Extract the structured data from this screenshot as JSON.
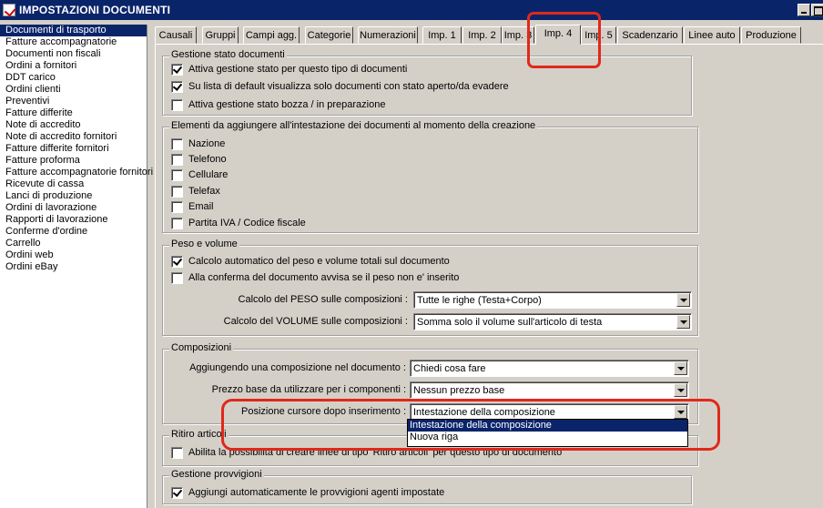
{
  "window": {
    "title": "IMPOSTAZIONI DOCUMENTI",
    "highlight_color": "#e0281a",
    "selection_color": "#0a246a"
  },
  "doc_list": [
    "Documenti di trasporto",
    "Fatture accompagnatorie",
    "Documenti non fiscali",
    "Ordini a fornitori",
    "DDT carico",
    "Ordini clienti",
    "Preventivi",
    "Fatture differite",
    "Note di accredito",
    "Note di accredito fornitori",
    "Fatture differite fornitori",
    "Fatture proforma",
    "Fatture accompagnatorie fornitori",
    "Ricevute di cassa",
    "Lanci di produzione",
    "Ordini di lavorazione",
    "Rapporti di lavorazione",
    "Conferme d'ordine",
    "Carrello",
    "Ordini web",
    "Ordini eBay"
  ],
  "doc_list_selected": "Documenti di trasporto",
  "tabs": [
    "Causali",
    "Gruppi",
    "Campi agg.",
    "Categorie",
    "Numerazioni",
    "Imp. 1",
    "Imp. 2",
    "Imp. 3",
    "Imp. 4",
    "Imp. 5",
    "Scadenzario",
    "Linee auto",
    "Produzione"
  ],
  "active_tab": "Imp. 4",
  "groups": {
    "stato": {
      "label": "Gestione stato documenti",
      "options": [
        {
          "label": "Attiva gestione stato per questo tipo di documenti",
          "checked": true
        },
        {
          "label": "Su lista di default visualizza solo documenti con stato aperto/da evadere",
          "checked": true
        },
        {
          "label": "Attiva gestione stato bozza / in preparazione",
          "checked": false
        }
      ]
    },
    "intestazione": {
      "label": "Elementi da aggiungere all'intestazione dei documenti al momento della creazione",
      "options": [
        {
          "label": "Nazione",
          "checked": false
        },
        {
          "label": "Telefono",
          "checked": false
        },
        {
          "label": "Cellulare",
          "checked": false
        },
        {
          "label": "Telefax",
          "checked": false
        },
        {
          "label": "Email",
          "checked": false
        },
        {
          "label": "Partita IVA / Codice fiscale",
          "checked": false
        }
      ]
    },
    "peso": {
      "label": "Peso e volume",
      "options": [
        {
          "label": "Calcolo automatico del peso e volume totali sul documento",
          "checked": true
        },
        {
          "label": "Alla conferma del documento avvisa se il peso non e' inserito",
          "checked": false
        }
      ],
      "peso_label": "Calcolo del PESO sulle composizioni :",
      "peso_value": "Tutte le righe (Testa+Corpo)",
      "volume_label": "Calcolo del VOLUME sulle composizioni :",
      "volume_value": "Somma solo il volume sull'articolo di testa"
    },
    "composizioni": {
      "label": "Composizioni",
      "aggiungendo_label": "Aggiungendo una composizione nel documento :",
      "aggiungendo_value": "Chiedi cosa fare",
      "prezzo_label": "Prezzo base da utilizzare per i componenti :",
      "prezzo_value": "Nessun prezzo base",
      "cursore_label": "Posizione cursore dopo inserimento :",
      "cursore_value": "Intestazione della composizione",
      "cursore_options": [
        "Intestazione della composizione",
        "Nuova riga"
      ]
    },
    "ritiro": {
      "label": "Ritiro articoli",
      "option_label": "Abilita la possibilità di creare linee di tipo 'Ritiro articoli' per questo tipo di documento",
      "checked": false
    },
    "provvigioni": {
      "label": "Gestione provvigioni",
      "option_label": "Aggiungi automaticamente le provvigioni agenti impostate",
      "checked": true
    }
  }
}
